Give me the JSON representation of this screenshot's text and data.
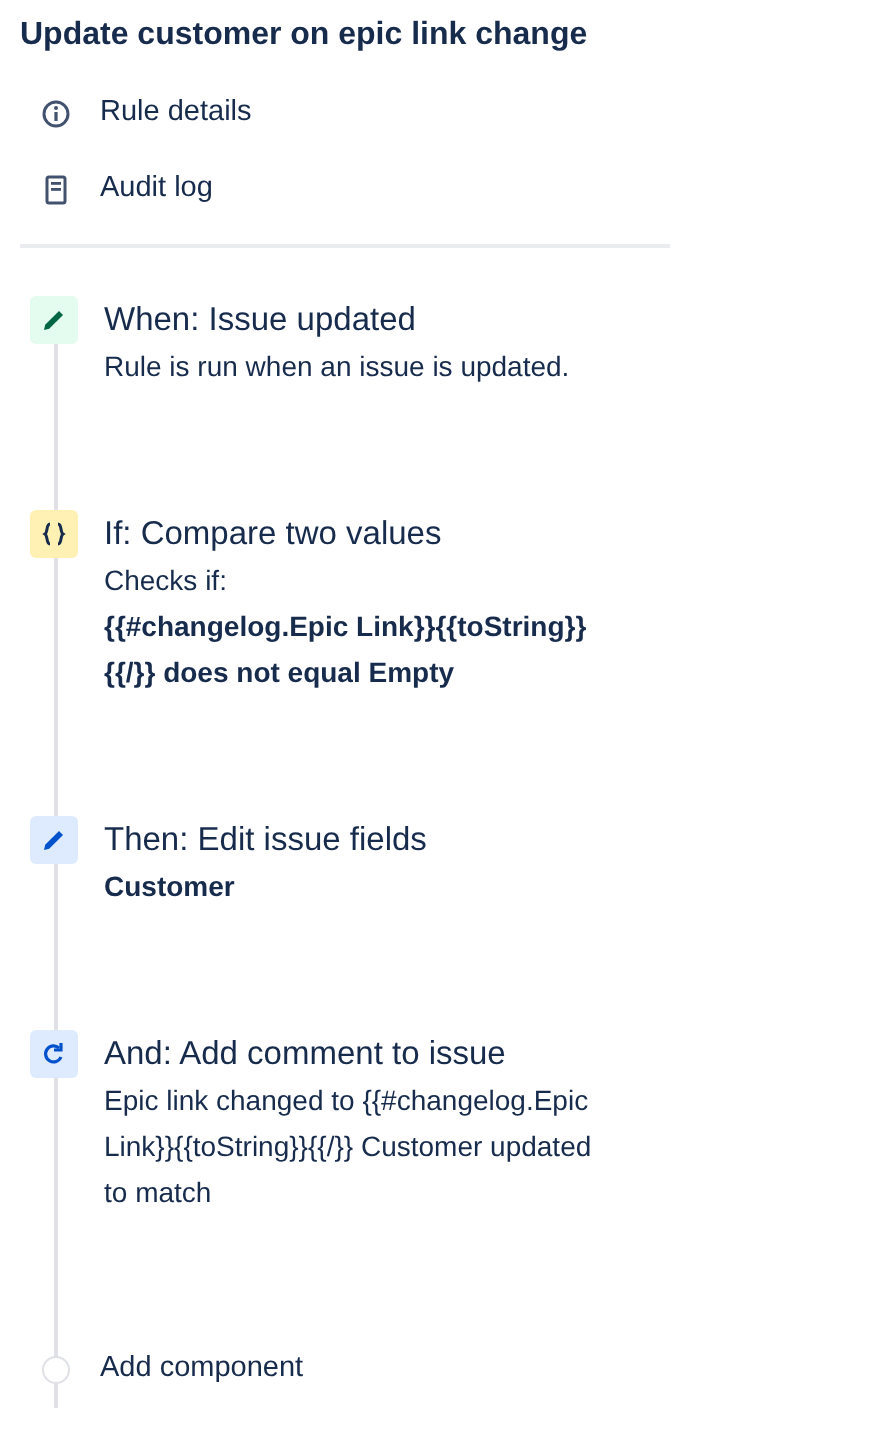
{
  "title": "Update customer on epic link change",
  "menu": [
    {
      "kind": "info",
      "label": "Rule details"
    },
    {
      "kind": "log",
      "label": "Audit log"
    }
  ],
  "steps": [
    {
      "kind": "trigger",
      "title": "When: Issue updated",
      "details": [
        {
          "text": "Rule is run when an issue is updated.",
          "bold": false
        }
      ]
    },
    {
      "kind": "condition",
      "title": "If: Compare two values",
      "details": [
        {
          "text": "Checks if:",
          "bold": false
        },
        {
          "text": "{{#changelog.Epic Link}}{{toString}} {{/}} does not equal Empty",
          "bold": true
        }
      ]
    },
    {
      "kind": "action",
      "title": "Then: Edit issue fields",
      "details": [
        {
          "text": "Customer",
          "bold": true
        }
      ]
    },
    {
      "kind": "comment",
      "title": "And: Add comment to issue",
      "details": [
        {
          "text": "Epic link changed to {{#changelog.Epic Link}}{{toString}}{{/}} Customer updated to match",
          "bold": false
        }
      ]
    }
  ],
  "add": {
    "label": "Add component"
  }
}
